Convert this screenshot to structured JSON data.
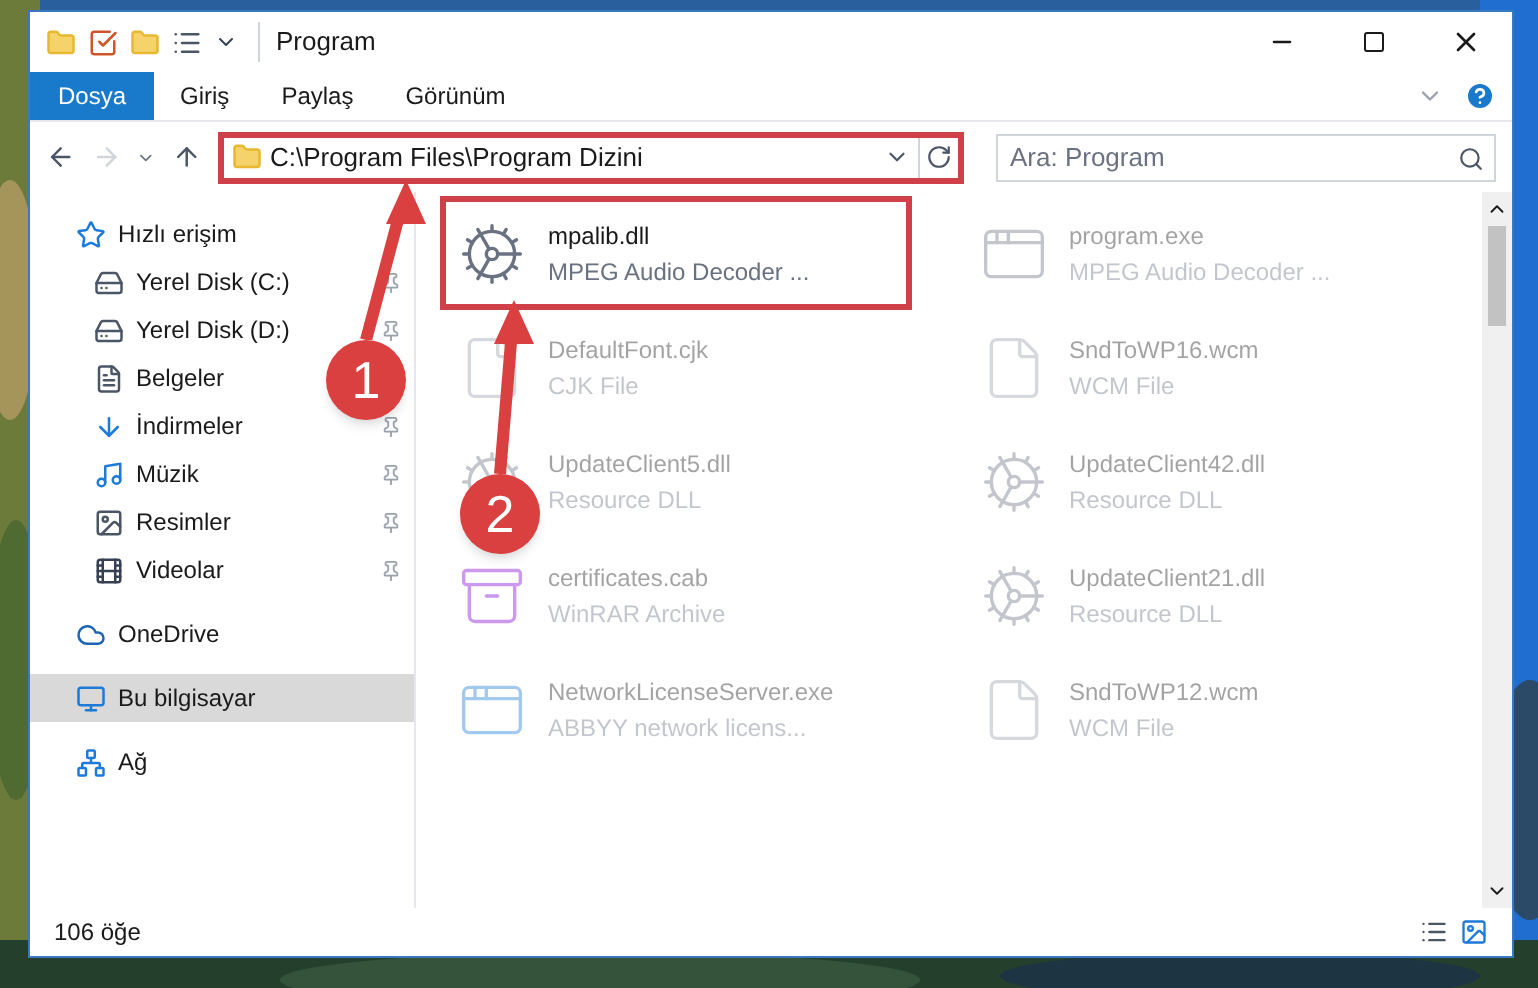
{
  "window": {
    "title": "Program"
  },
  "ribbon_tabs": [
    {
      "label": "Dosya",
      "kind": "file"
    },
    {
      "label": "Giriş",
      "kind": "tab"
    },
    {
      "label": "Paylaş",
      "kind": "tab"
    },
    {
      "label": "Görünüm",
      "kind": "tab"
    }
  ],
  "address_bar": {
    "path": "C:\\Program Files\\Program Dizini",
    "highlighted": true
  },
  "search": {
    "placeholder": "Ara: Program"
  },
  "sidebar": {
    "items": [
      {
        "label": "Hızlı erişim",
        "kind": "quickaccess",
        "pinned": false,
        "selected": false
      },
      {
        "label": "Yerel Disk (C:)",
        "kind": "drive",
        "pinned": true,
        "selected": false
      },
      {
        "label": "Yerel Disk (D:)",
        "kind": "drive",
        "pinned": true,
        "selected": false
      },
      {
        "label": "Belgeler",
        "kind": "documents",
        "pinned": false,
        "selected": false
      },
      {
        "label": "İndirmeler",
        "kind": "downloads",
        "pinned": true,
        "selected": false
      },
      {
        "label": "Müzik",
        "kind": "music",
        "pinned": true,
        "selected": false
      },
      {
        "label": "Resimler",
        "kind": "pictures",
        "pinned": true,
        "selected": false
      },
      {
        "label": "Videolar",
        "kind": "videos",
        "pinned": true,
        "selected": false
      },
      {
        "label": "OneDrive",
        "kind": "cloud",
        "pinned": false,
        "selected": false
      },
      {
        "label": "Bu bilgisayar",
        "kind": "computer",
        "pinned": false,
        "selected": true
      },
      {
        "label": "Ağ",
        "kind": "network",
        "pinned": false,
        "selected": false
      }
    ]
  },
  "files": [
    {
      "name": "mpalib.dll",
      "type": "MPEG Audio Decoder ...",
      "kind": "dll",
      "blurred": false,
      "highlighted": true
    },
    {
      "name": "program.exe",
      "type": "MPEG Audio Decoder ...",
      "kind": "exe",
      "blurred": true,
      "highlighted": false
    },
    {
      "name": "DefaultFont.cjk",
      "type": "CJK File",
      "kind": "blank",
      "blurred": true,
      "highlighted": false
    },
    {
      "name": "SndToWP16.wcm",
      "type": "WCM File",
      "kind": "blank",
      "blurred": true,
      "highlighted": false
    },
    {
      "name": "UpdateClient5.dll",
      "type": "Resource DLL",
      "kind": "dll",
      "blurred": true,
      "highlighted": false
    },
    {
      "name": "UpdateClient42.dll",
      "type": "Resource DLL",
      "kind": "dll",
      "blurred": true,
      "highlighted": false
    },
    {
      "name": "certificates.cab",
      "type": "WinRAR Archive",
      "kind": "archive",
      "blurred": true,
      "highlighted": false
    },
    {
      "name": "UpdateClient21.dll",
      "type": "Resource DLL",
      "kind": "dll",
      "blurred": true,
      "highlighted": false
    },
    {
      "name": "NetworkLicenseServer.exe",
      "type": "ABBYY network licens...",
      "kind": "app",
      "blurred": true,
      "highlighted": false
    },
    {
      "name": "SndToWP12.wcm",
      "type": "WCM File",
      "kind": "blank",
      "blurred": true,
      "highlighted": false
    }
  ],
  "annotations": [
    {
      "label": "1"
    },
    {
      "label": "2"
    }
  ],
  "status_bar": {
    "item_count": "106 öğe"
  }
}
